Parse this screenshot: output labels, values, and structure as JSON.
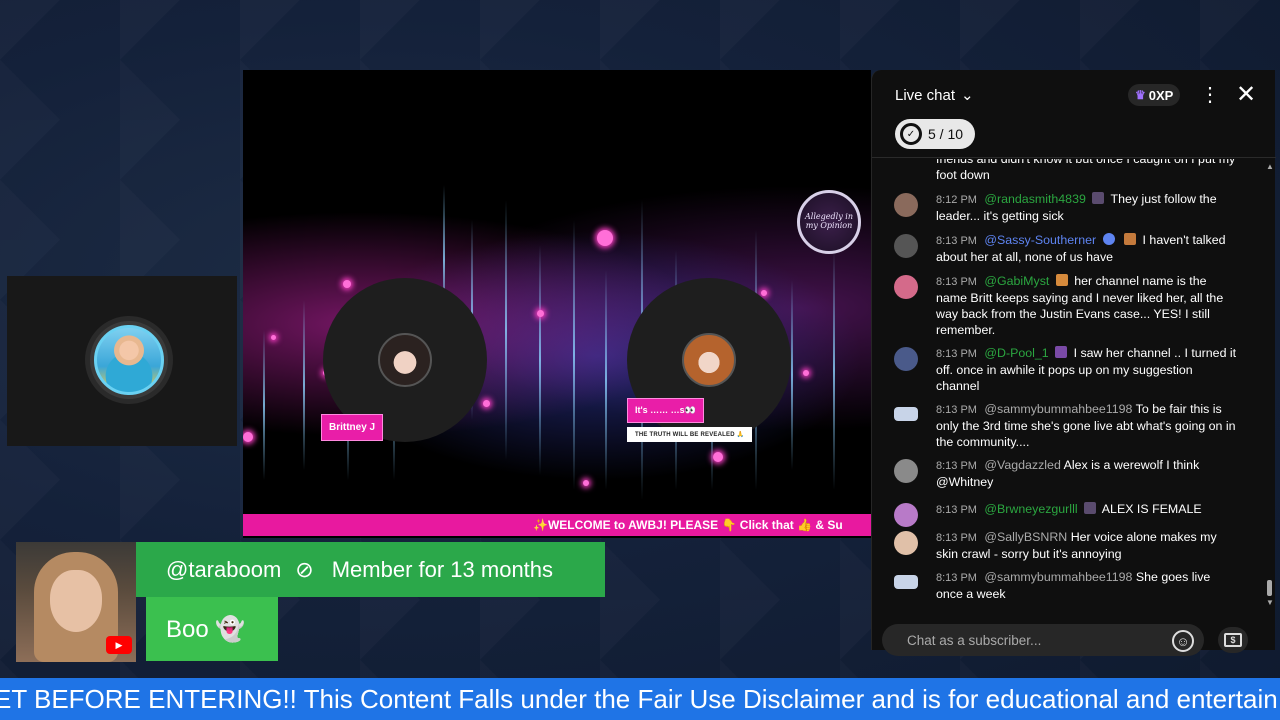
{
  "stage": {
    "participants": [
      {
        "name": "Brittney J"
      },
      {
        "name": "It's …… …s👀",
        "subtitle": "THE TRUTH WILL BE REVEALED 🙏"
      }
    ],
    "logo_text": "Allegedly in my Opinion",
    "ticker": "✨WELCOME to AWBJ! PLEASE 👇 Click that 👍 & Su"
  },
  "member_alert": {
    "handle": "@taraboom",
    "membership": "Member for 13 months",
    "message": "Boo 👻",
    "yt_icon": "youtube-play-icon"
  },
  "bottom_ticker": {
    "text": "ET BEFORE ENTERING!! This Content Falls under the Fair Use Disclaimer and is for educational and entertain"
  },
  "chat": {
    "title": "Live chat",
    "xp": "0XP",
    "goal": "5 / 10",
    "input_placeholder": "Chat as a subscriber...",
    "messages": [
      {
        "time": "",
        "author": "",
        "text": "friends and didn't know it but once I caught on I put my foot down"
      },
      {
        "time": "8:12 PM",
        "author": "@randasmith4839",
        "text": "They just follow the leader... it's getting sick"
      },
      {
        "time": "8:13 PM",
        "author": "@Sassy-Southerner",
        "text": "I haven't talked about her at all, none of us have"
      },
      {
        "time": "8:13 PM",
        "author": "@GabiMyst",
        "text": "her channel name is the name Britt keeps saying and I never liked her, all the way back from the Justin Evans case... YES! I still remember."
      },
      {
        "time": "8:13 PM",
        "author": "@D-Pool_1",
        "text": "I saw her channel .. I turned it off. once in awhile it pops up on my suggestion channel"
      },
      {
        "time": "8:13 PM",
        "author": "@sammybummahbee1198",
        "text": "To be fair this is only the 3rd time she's gone live abt what's going on in the community...."
      },
      {
        "time": "8:13 PM",
        "author": "@Vagdazzled",
        "text": "Alex is a werewolf I think @Whitney"
      },
      {
        "time": "8:13 PM",
        "author": "@Brwneyezgurlll",
        "text": "ALEX IS FEMALE"
      },
      {
        "time": "8:13 PM",
        "author": "@SallyBSNRN",
        "text": "Her voice alone makes my skin crawl - sorry but it's annoying"
      },
      {
        "time": "8:13 PM",
        "author": "@sammybummahbee1198",
        "text": "She goes live once a week"
      }
    ]
  },
  "colors": {
    "member_green": "#2ba84a",
    "ticker_blue": "#1f74e6",
    "stage_pink": "#e8199f",
    "chat_bg": "#0f0f0f"
  }
}
